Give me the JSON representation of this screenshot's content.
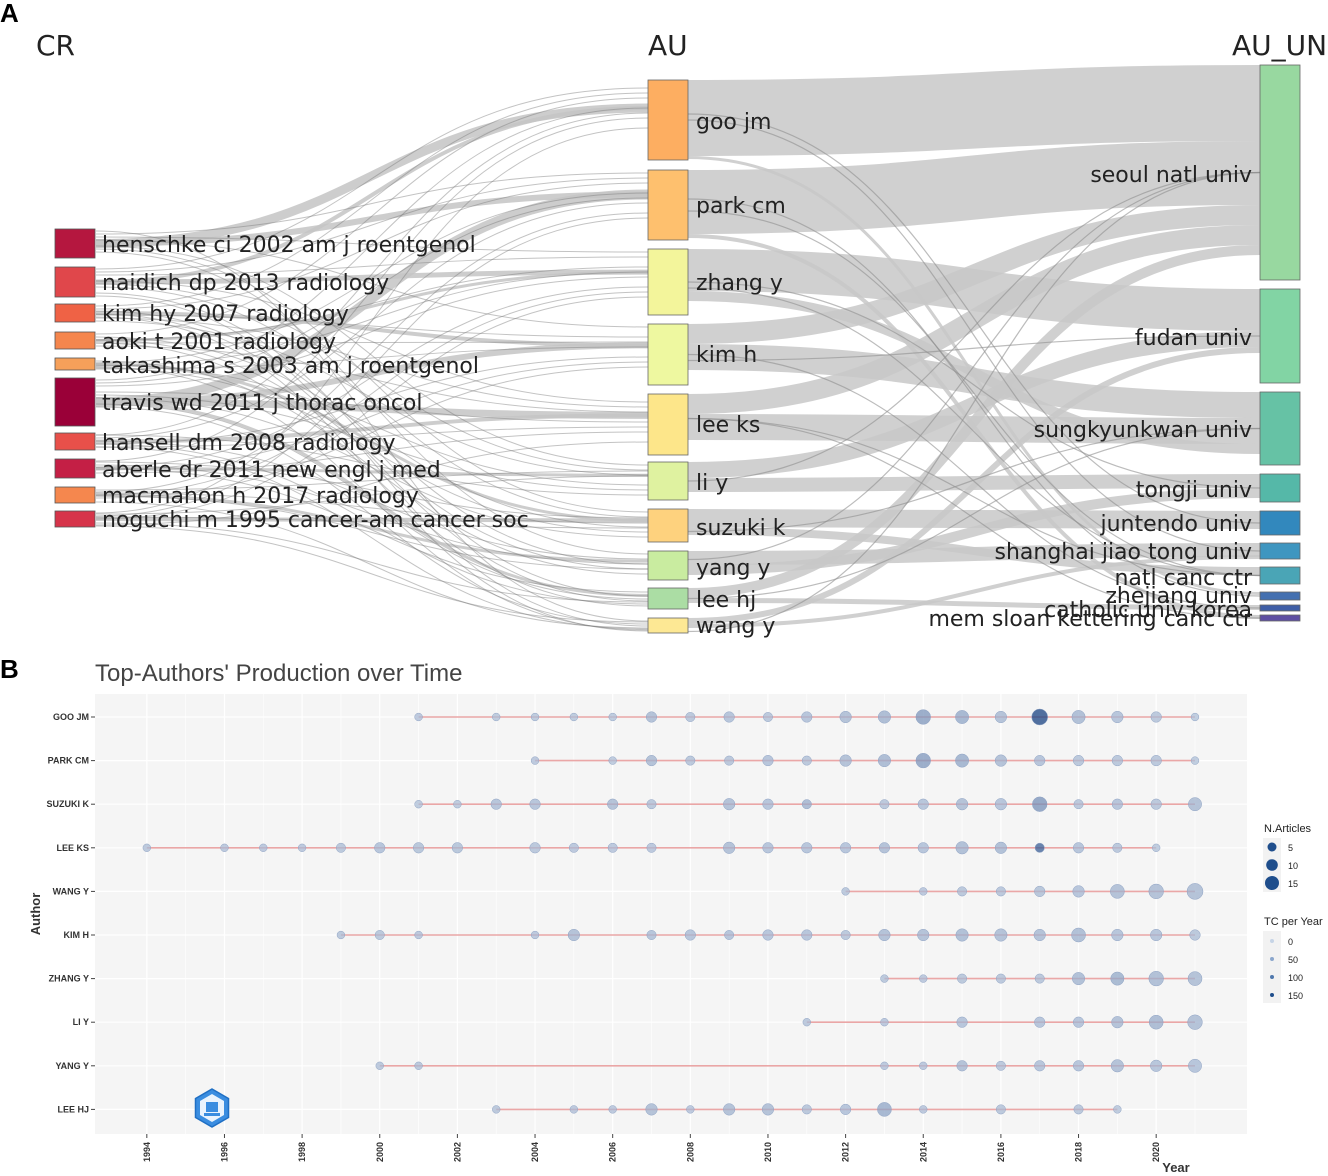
{
  "panel_a": {
    "letter": "A",
    "columns": [
      "CR",
      "AU",
      "AU_UN"
    ],
    "cr_nodes": [
      {
        "label": "henschke ci 2002 am j roentgenol",
        "color": "#b5173f"
      },
      {
        "label": "naidich dp 2013 radiology",
        "color": "#e0474b"
      },
      {
        "label": "kim hy 2007 radiology",
        "color": "#ef6245"
      },
      {
        "label": "aoki t 2001 radiology",
        "color": "#f5864d"
      },
      {
        "label": "takashima s 2003 am j roentgenol",
        "color": "#f6a05a"
      },
      {
        "label": "travis wd 2011 j thorac oncol",
        "color": "#9a0038"
      },
      {
        "label": "hansell dm 2008 radiology",
        "color": "#e8504a"
      },
      {
        "label": "aberle dr 2011 new engl j med",
        "color": "#c41f45"
      },
      {
        "label": "macmahon h 2017 radiology",
        "color": "#f5874e"
      },
      {
        "label": "noguchi m 1995 cancer-am cancer soc",
        "color": "#d6344a"
      }
    ],
    "au_nodes": [
      {
        "label": "goo jm",
        "color": "#fdae61"
      },
      {
        "label": "park cm",
        "color": "#fec06e"
      },
      {
        "label": "zhang y",
        "color": "#f3f59b"
      },
      {
        "label": "kim h",
        "color": "#eef8a0"
      },
      {
        "label": "lee ks",
        "color": "#fde68a"
      },
      {
        "label": "li y",
        "color": "#dff2a0"
      },
      {
        "label": "suzuki k",
        "color": "#fed27e"
      },
      {
        "label": "yang y",
        "color": "#c9eca0"
      },
      {
        "label": "lee hj",
        "color": "#abdda4"
      },
      {
        "label": "wang y",
        "color": "#fde894"
      }
    ],
    "un_nodes": [
      {
        "label": "seoul natl univ",
        "color": "#98d8a0"
      },
      {
        "label": "fudan univ",
        "color": "#82d4a4"
      },
      {
        "label": "sungkyunkwan univ",
        "color": "#66c2a5"
      },
      {
        "label": "tongji univ",
        "color": "#55b8a8"
      },
      {
        "label": "juntendo univ",
        "color": "#3288bd"
      },
      {
        "label": "shanghai jiao tong univ",
        "color": "#3f96c0"
      },
      {
        "label": "natl canc ctr",
        "color": "#4aa5b6"
      },
      {
        "label": "zhejiang univ",
        "color": "#4470b0"
      },
      {
        "label": "catholic univ korea",
        "color": "#3f5ea6"
      },
      {
        "label": "mem sloan kettering canc ctr",
        "color": "#5e4fa2"
      }
    ]
  },
  "panel_b": {
    "letter": "B",
    "title": "Top-Authors' Production over Time",
    "legend": {
      "size_title": "N.Articles",
      "size_values": [
        "5",
        "10",
        "15"
      ],
      "color_title": "TC per Year",
      "color_values": [
        "0",
        "50",
        "100",
        "150"
      ]
    }
  },
  "chart_data": {
    "type": "scatter",
    "title": "Top-Authors' Production over Time",
    "xlabel": "Year",
    "ylabel": "Author",
    "xlim": [
      1993,
      2022
    ],
    "x_ticks": [
      "1994",
      "1996",
      "1998",
      "2000",
      "2002",
      "2004",
      "2006",
      "2008",
      "2010",
      "2012",
      "2014",
      "2016",
      "2018",
      "2020"
    ],
    "authors": [
      {
        "name": "GOO JM",
        "points": [
          [
            2001,
            1,
            8
          ],
          [
            2003,
            1,
            5
          ],
          [
            2004,
            1,
            5
          ],
          [
            2005,
            1,
            5
          ],
          [
            2006,
            1,
            5
          ],
          [
            2007,
            3,
            20
          ],
          [
            2008,
            2,
            10
          ],
          [
            2009,
            3,
            15
          ],
          [
            2010,
            2,
            10
          ],
          [
            2011,
            3,
            15
          ],
          [
            2012,
            4,
            20
          ],
          [
            2013,
            5,
            30
          ],
          [
            2014,
            8,
            60
          ],
          [
            2015,
            6,
            40
          ],
          [
            2016,
            4,
            20
          ],
          [
            2017,
            10,
            180
          ],
          [
            2018,
            6,
            25
          ],
          [
            2019,
            4,
            15
          ],
          [
            2020,
            3,
            10
          ],
          [
            2021,
            1,
            2
          ]
        ]
      },
      {
        "name": "PARK CM",
        "points": [
          [
            2004,
            1,
            8
          ],
          [
            2006,
            1,
            5
          ],
          [
            2007,
            3,
            20
          ],
          [
            2008,
            2,
            10
          ],
          [
            2009,
            2,
            10
          ],
          [
            2010,
            3,
            15
          ],
          [
            2011,
            2,
            10
          ],
          [
            2012,
            4,
            20
          ],
          [
            2013,
            5,
            30
          ],
          [
            2014,
            8,
            60
          ],
          [
            2015,
            6,
            40
          ],
          [
            2016,
            4,
            20
          ],
          [
            2017,
            3,
            15
          ],
          [
            2018,
            3,
            10
          ],
          [
            2019,
            3,
            10
          ],
          [
            2020,
            3,
            10
          ],
          [
            2021,
            1,
            2
          ]
        ]
      },
      {
        "name": "SUZUKI K",
        "points": [
          [
            2001,
            1,
            5
          ],
          [
            2002,
            1,
            5
          ],
          [
            2003,
            3,
            15
          ],
          [
            2004,
            3,
            15
          ],
          [
            2006,
            3,
            20
          ],
          [
            2007,
            2,
            10
          ],
          [
            2009,
            4,
            20
          ],
          [
            2010,
            3,
            15
          ],
          [
            2011,
            2,
            30
          ],
          [
            2013,
            2,
            10
          ],
          [
            2014,
            3,
            15
          ],
          [
            2015,
            4,
            20
          ],
          [
            2016,
            4,
            15
          ],
          [
            2017,
            8,
            70
          ],
          [
            2018,
            2,
            10
          ],
          [
            2019,
            3,
            15
          ],
          [
            2020,
            3,
            10
          ],
          [
            2021,
            6,
            20
          ]
        ]
      },
      {
        "name": "LEE KS",
        "points": [
          [
            1994,
            1,
            10
          ],
          [
            1996,
            1,
            8
          ],
          [
            1997,
            1,
            8
          ],
          [
            1998,
            1,
            8
          ],
          [
            1999,
            2,
            10
          ],
          [
            2000,
            3,
            15
          ],
          [
            2001,
            3,
            12
          ],
          [
            2002,
            3,
            12
          ],
          [
            2004,
            3,
            10
          ],
          [
            2005,
            2,
            8
          ],
          [
            2006,
            2,
            8
          ],
          [
            2007,
            2,
            8
          ],
          [
            2009,
            4,
            20
          ],
          [
            2010,
            3,
            15
          ],
          [
            2011,
            3,
            15
          ],
          [
            2012,
            3,
            15
          ],
          [
            2013,
            3,
            20
          ],
          [
            2014,
            3,
            15
          ],
          [
            2015,
            5,
            25
          ],
          [
            2016,
            4,
            25
          ],
          [
            2017,
            2,
            140
          ],
          [
            2018,
            3,
            15
          ],
          [
            2019,
            2,
            10
          ],
          [
            2020,
            1,
            5
          ]
        ]
      },
      {
        "name": "WANG Y",
        "points": [
          [
            2012,
            1,
            10
          ],
          [
            2014,
            1,
            8
          ],
          [
            2015,
            2,
            10
          ],
          [
            2016,
            2,
            10
          ],
          [
            2017,
            3,
            12
          ],
          [
            2018,
            4,
            15
          ],
          [
            2019,
            7,
            20
          ],
          [
            2020,
            8,
            20
          ],
          [
            2021,
            10,
            20
          ]
        ]
      },
      {
        "name": "KIM H",
        "points": [
          [
            1999,
            1,
            10
          ],
          [
            2000,
            2,
            10
          ],
          [
            2001,
            1,
            8
          ],
          [
            2004,
            1,
            8
          ],
          [
            2005,
            4,
            20
          ],
          [
            2007,
            2,
            15
          ],
          [
            2008,
            3,
            15
          ],
          [
            2009,
            2,
            15
          ],
          [
            2010,
            3,
            15
          ],
          [
            2011,
            3,
            15
          ],
          [
            2012,
            2,
            10
          ],
          [
            2013,
            4,
            20
          ],
          [
            2014,
            4,
            20
          ],
          [
            2015,
            5,
            25
          ],
          [
            2016,
            5,
            20
          ],
          [
            2017,
            4,
            20
          ],
          [
            2018,
            7,
            25
          ],
          [
            2019,
            4,
            15
          ],
          [
            2020,
            4,
            15
          ],
          [
            2021,
            3,
            10
          ]
        ]
      },
      {
        "name": "ZHANG Y",
        "points": [
          [
            2013,
            1,
            10
          ],
          [
            2014,
            1,
            8
          ],
          [
            2015,
            2,
            10
          ],
          [
            2016,
            2,
            10
          ],
          [
            2017,
            2,
            10
          ],
          [
            2018,
            5,
            25
          ],
          [
            2019,
            6,
            35
          ],
          [
            2020,
            8,
            25
          ],
          [
            2021,
            7,
            20
          ]
        ]
      },
      {
        "name": "LI Y",
        "points": [
          [
            2011,
            1,
            10
          ],
          [
            2013,
            1,
            8
          ],
          [
            2015,
            3,
            15
          ],
          [
            2017,
            3,
            15
          ],
          [
            2018,
            3,
            15
          ],
          [
            2019,
            4,
            20
          ],
          [
            2020,
            7,
            30
          ],
          [
            2021,
            8,
            20
          ]
        ]
      },
      {
        "name": "YANG Y",
        "points": [
          [
            2000,
            1,
            10
          ],
          [
            2001,
            1,
            10
          ],
          [
            2013,
            1,
            8
          ],
          [
            2014,
            1,
            8
          ],
          [
            2015,
            3,
            20
          ],
          [
            2016,
            2,
            10
          ],
          [
            2017,
            3,
            15
          ],
          [
            2018,
            3,
            15
          ],
          [
            2019,
            5,
            20
          ],
          [
            2020,
            4,
            15
          ],
          [
            2021,
            6,
            15
          ]
        ]
      },
      {
        "name": "LEE HJ",
        "points": [
          [
            2003,
            1,
            10
          ],
          [
            2005,
            1,
            8
          ],
          [
            2006,
            1,
            8
          ],
          [
            2007,
            4,
            20
          ],
          [
            2008,
            1,
            8
          ],
          [
            2009,
            4,
            20
          ],
          [
            2010,
            4,
            20
          ],
          [
            2011,
            2,
            10
          ],
          [
            2012,
            3,
            15
          ],
          [
            2013,
            7,
            40
          ],
          [
            2014,
            1,
            8
          ],
          [
            2016,
            2,
            10
          ],
          [
            2018,
            2,
            10
          ],
          [
            2019,
            1,
            5
          ]
        ]
      }
    ]
  }
}
